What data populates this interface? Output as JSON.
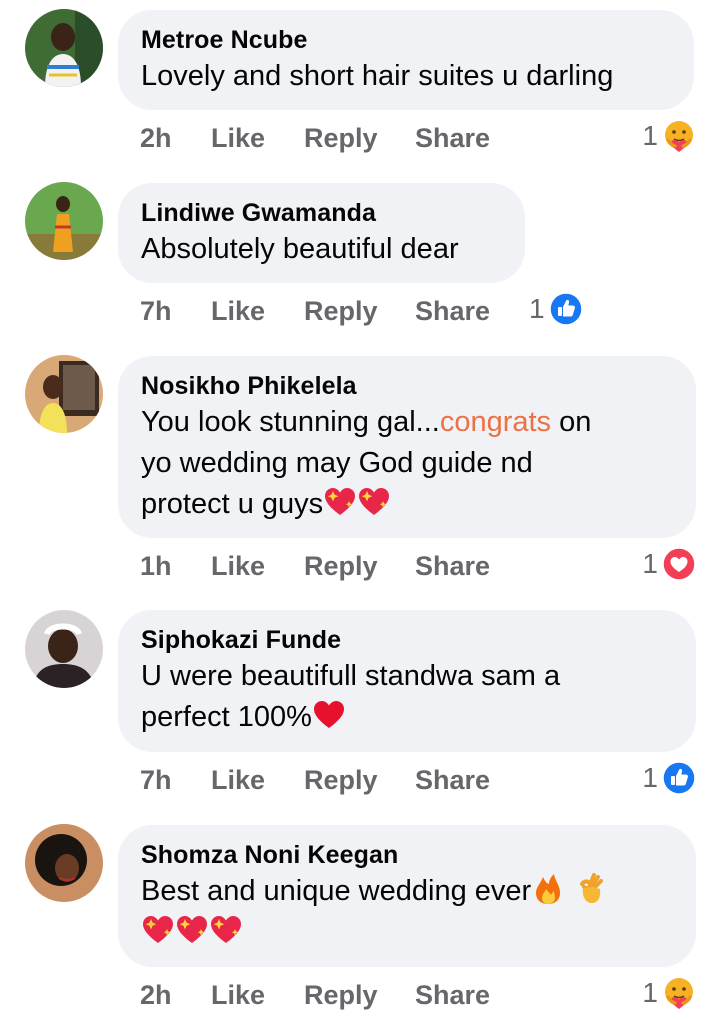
{
  "comments": [
    {
      "author": "Metroe Ncube",
      "text": "Lovely and short hair suites u darling",
      "time": "2h",
      "like": "Like",
      "reply": "Reply",
      "share": "Share",
      "reaction_count": "1",
      "reaction": "care-reaction-icon"
    },
    {
      "author": "Lindiwe Gwamanda",
      "text": "Absolutely beautiful dear",
      "time": "7h",
      "like": "Like",
      "reply": "Reply",
      "share": "Share",
      "reaction_count": "1",
      "reaction": "like-reaction-icon"
    },
    {
      "author": "Nosikho Phikelela",
      "text_before": "You look stunning gal...",
      "text_tag": "congrats",
      "text_after1": " on",
      "text_line2": "yo wedding may God guide nd",
      "text_line3": "protect u guys",
      "time": "1h",
      "like": "Like",
      "reply": "Reply",
      "share": "Share",
      "reaction_count": "1",
      "reaction": "love-reaction-icon"
    },
    {
      "author": "Siphokazi Funde",
      "text_line1": "U were beautifull standwa sam  a",
      "text_line2": "perfect 100%",
      "time": "7h",
      "like": "Like",
      "reply": "Reply",
      "share": "Share",
      "reaction_count": "1",
      "reaction": "like-reaction-icon"
    },
    {
      "author": "Shomza Noni Keegan",
      "text_line1": "Best and unique wedding ever",
      "time": "2h",
      "like": "Like",
      "reply": "Reply",
      "share": "Share",
      "reaction_count": "1",
      "reaction": "care-reaction-icon"
    }
  ],
  "colors": {
    "bubble": "#f0f2f5",
    "action_text": "#65676b",
    "tag": "#ee7146",
    "like_blue": "#1877f2",
    "love_red": "#f33e58",
    "care_yellow": "#f7b125"
  }
}
